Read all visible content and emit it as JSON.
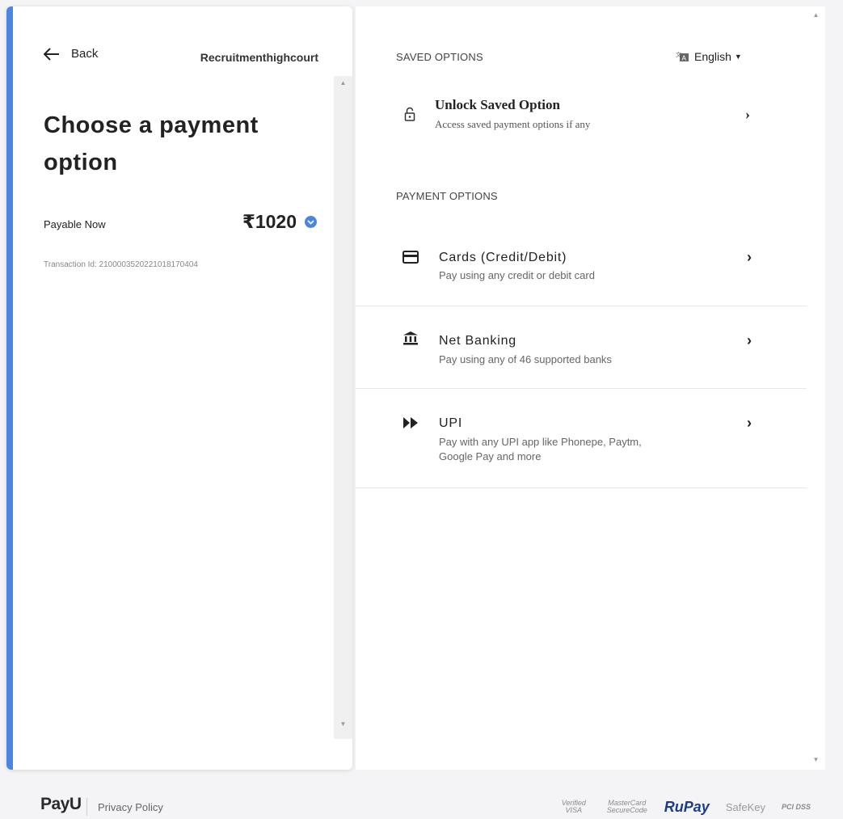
{
  "header": {
    "back_label": "Back",
    "merchant": "Recruitmenthighcourt"
  },
  "summary": {
    "title": "Choose a payment option",
    "payable_label": "Payable Now",
    "amount": "₹1020",
    "transaction": "Transaction Id: 2100003520221018170404"
  },
  "saved": {
    "heading": "SAVED OPTIONS",
    "language": "English",
    "unlock_title": "Unlock Saved Option",
    "unlock_sub": "Access saved payment options if any"
  },
  "payment": {
    "heading": "PAYMENT OPTIONS",
    "options": [
      {
        "name": "Cards (Credit/Debit)",
        "sub": "Pay using any credit or debit card",
        "icon": "card-icon"
      },
      {
        "name": "Net Banking",
        "sub": "Pay using any of 46 supported banks",
        "icon": "bank-icon"
      },
      {
        "name": "UPI",
        "sub": "Pay with any UPI app like Phonepe, Paytm, Google Pay and more",
        "icon": "upi-icon"
      }
    ]
  },
  "footer": {
    "brand": "PayU",
    "privacy": "Privacy Policy",
    "badges": [
      "Verified VISA",
      "MasterCard SecureCode",
      "RuPay",
      "SafeKey",
      "PCI DSS"
    ]
  },
  "colors": {
    "accent": "#4a86e0",
    "rupay": "#1c3d84"
  }
}
